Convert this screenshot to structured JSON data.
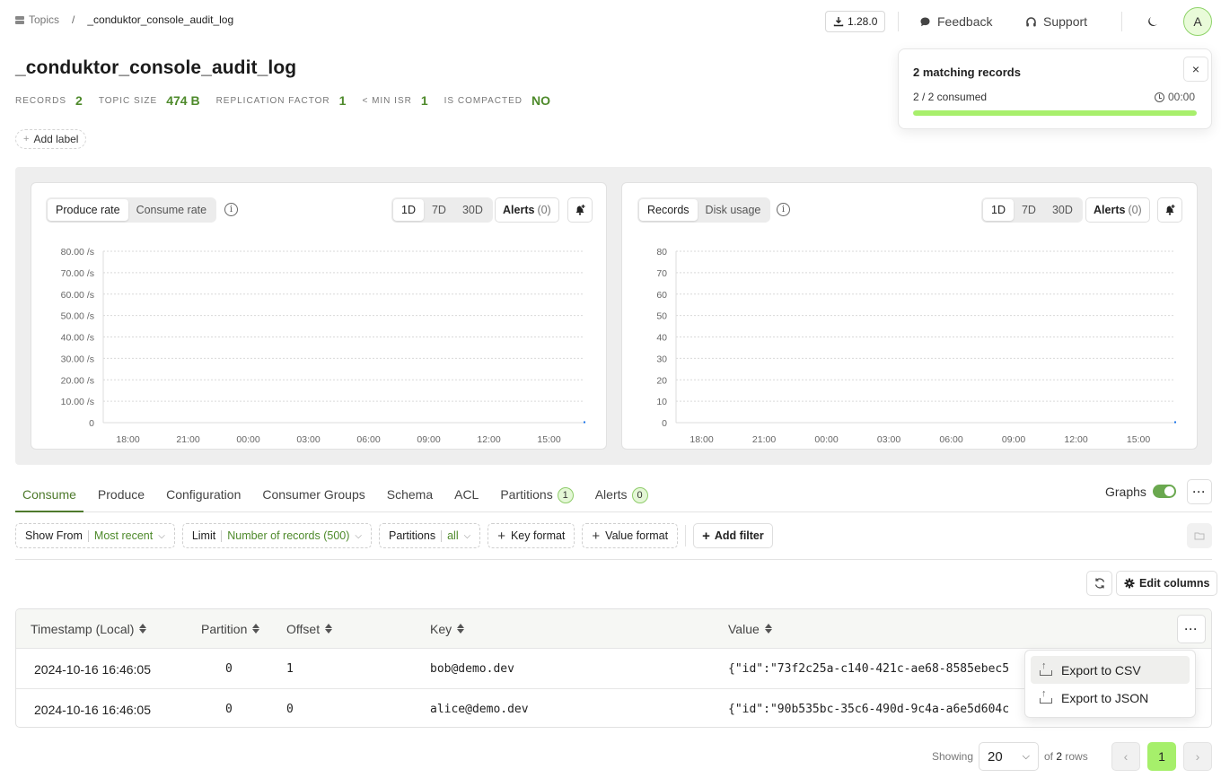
{
  "breadcrumb": {
    "root_label": "Topics",
    "separator": "/",
    "current": "_conduktor_console_audit_log"
  },
  "header": {
    "version_label": "1.28.0",
    "feedback_label": "Feedback",
    "support_label": "Support",
    "avatar_initial": "A"
  },
  "topic": {
    "title": "_conduktor_console_audit_log",
    "stats": [
      {
        "label": "Records",
        "value": "2"
      },
      {
        "label": "Topic size",
        "value": "474 B"
      },
      {
        "label": "Replication factor",
        "value": "1"
      },
      {
        "label": "< Min ISR",
        "value": "1"
      },
      {
        "label": "Is compacted",
        "value": "NO"
      }
    ],
    "add_label": "Add label"
  },
  "toast": {
    "title": "2 matching records",
    "consumed_text": "2 / 2 consumed",
    "elapsed": "00:00",
    "progress_fraction": 1.0,
    "close_label": "×",
    "progress_color": "#a8ef6c"
  },
  "charts": {
    "left": {
      "tabs": [
        "Produce rate",
        "Consume rate"
      ],
      "active_tab": 0,
      "ranges": [
        "1D",
        "7D",
        "30D"
      ],
      "active_range": 0,
      "alerts_label": "Alerts",
      "alerts_count": "(0)"
    },
    "right": {
      "tabs": [
        "Records",
        "Disk usage"
      ],
      "active_tab": 0,
      "ranges": [
        "1D",
        "7D",
        "30D"
      ],
      "active_range": 0,
      "alerts_label": "Alerts",
      "alerts_count": "(0)"
    }
  },
  "chart_data": [
    {
      "type": "line",
      "title": "Produce rate",
      "xlabel": "",
      "ylabel": "",
      "x_ticks": [
        "18:00",
        "21:00",
        "00:00",
        "03:00",
        "06:00",
        "09:00",
        "12:00",
        "15:00"
      ],
      "y_ticks": [
        "0",
        "10.00 /s",
        "20.00 /s",
        "30.00 /s",
        "40.00 /s",
        "50.00 /s",
        "60.00 /s",
        "70.00 /s",
        "80.00 /s"
      ],
      "ylim": [
        0,
        80
      ],
      "grid": true,
      "series": [
        {
          "name": "Produce rate",
          "color": "#1a73e8",
          "points": [
            {
              "x": "16:46",
              "y": 0
            }
          ]
        }
      ]
    },
    {
      "type": "line",
      "title": "Records",
      "xlabel": "",
      "ylabel": "",
      "x_ticks": [
        "18:00",
        "21:00",
        "00:00",
        "03:00",
        "06:00",
        "09:00",
        "12:00",
        "15:00"
      ],
      "y_ticks": [
        "0",
        "10",
        "20",
        "30",
        "40",
        "50",
        "60",
        "70",
        "80"
      ],
      "ylim": [
        0,
        80
      ],
      "grid": true,
      "series": [
        {
          "name": "Records",
          "color": "#1a73e8",
          "points": [
            {
              "x": "16:46",
              "y": 0
            }
          ]
        }
      ]
    }
  ],
  "tabs": [
    {
      "label": "Consume",
      "active": true
    },
    {
      "label": "Produce"
    },
    {
      "label": "Configuration"
    },
    {
      "label": "Consumer Groups"
    },
    {
      "label": "Schema"
    },
    {
      "label": "ACL"
    },
    {
      "label": "Partitions",
      "badge": "1"
    },
    {
      "label": "Alerts",
      "badge": "0"
    }
  ],
  "graphs_toggle": {
    "label": "Graphs",
    "on": true
  },
  "filters": {
    "show_from": {
      "label": "Show From",
      "value": "Most recent"
    },
    "limit": {
      "label": "Limit",
      "value": "Number of records (500)"
    },
    "partitions": {
      "label": "Partitions",
      "value": "all"
    },
    "key_format": "Key format",
    "value_format": "Value format",
    "add_filter": "Add filter"
  },
  "toolbar": {
    "edit_columns": "Edit columns"
  },
  "table": {
    "columns": [
      "Timestamp (Local)",
      "Partition",
      "Offset",
      "Key",
      "Value"
    ],
    "rows": [
      {
        "timestamp": "2024-10-16 16:46:05",
        "partition": "0",
        "offset": "1",
        "key": "bob@demo.dev",
        "value": "{\"id\":\"73f2c25a-c140-421c-ae68-8585ebec5"
      },
      {
        "timestamp": "2024-10-16 16:46:05",
        "partition": "0",
        "offset": "0",
        "key": "alice@demo.dev",
        "value": "{\"id\":\"90b535bc-35c6-490d-9c4a-a6e5d604c"
      }
    ]
  },
  "export_menu": {
    "items": [
      "Export to CSV",
      "Export to JSON"
    ]
  },
  "pagination": {
    "showing_label": "Showing",
    "page_size": "20",
    "of_label": "of",
    "total_rows": "2",
    "rows_label": "rows",
    "current_page": "1"
  }
}
